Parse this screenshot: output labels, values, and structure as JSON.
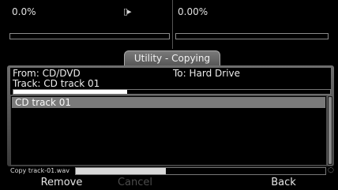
{
  "top": {
    "left": {
      "percent": "0.0%",
      "progress": 0.0
    },
    "right": {
      "percent": "0.00%",
      "progress": 0.0
    },
    "icon": "device-arrow-icon"
  },
  "dialog": {
    "title": "Utility - Copying",
    "from": "From: CD/DVD",
    "to": "To: Hard Drive",
    "track": "Track: CD track 01",
    "track_progress": 0.36
  },
  "list": {
    "items": [
      {
        "label": "CD track 01",
        "selected": true
      }
    ]
  },
  "status": {
    "label": "Copy track-01.wav",
    "progress": 0.36
  },
  "softkeys": {
    "remove": "Remove",
    "cancel": "Cancel",
    "back": "Back"
  },
  "colors": {
    "selection": "#7a7a7a",
    "disabled_text": "#4c4c4c"
  }
}
